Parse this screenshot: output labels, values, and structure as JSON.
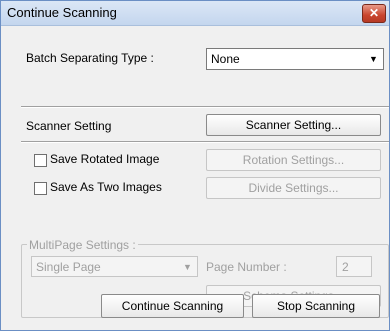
{
  "window": {
    "title": "Continue Scanning",
    "close_label": "✕"
  },
  "batch": {
    "label": "Batch Separating Type :",
    "selected": "None"
  },
  "scanner": {
    "label": "Scanner Setting",
    "button": "Scanner Setting..."
  },
  "rotated": {
    "label": "Save Rotated Image",
    "button": "Rotation Settings..."
  },
  "two_images": {
    "label": "Save As Two Images",
    "button": "Divide Settings..."
  },
  "multipage": {
    "legend": "MultiPage Settings :",
    "mode_selected": "Single Page",
    "page_number_label": "Page Number :",
    "page_number_value": "2",
    "schema_button": "Schema Settings..."
  },
  "footer": {
    "continue_button": "Continue Scanning",
    "stop_button": "Stop Scanning"
  },
  "icons": {
    "close": "close-icon",
    "dropdown": "chevron-down-icon",
    "checkbox": "checkbox-unchecked"
  }
}
